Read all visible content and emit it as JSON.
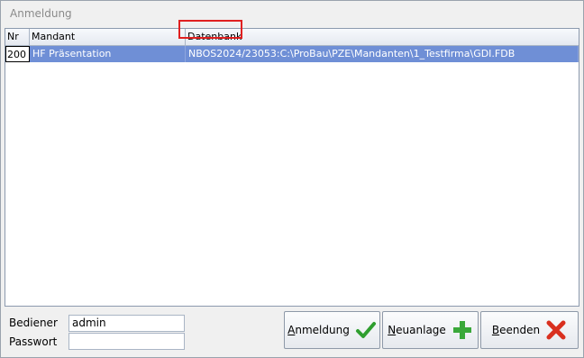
{
  "window": {
    "title": "Anmeldung"
  },
  "grid": {
    "columns": [
      "Nr",
      "Mandant",
      "Datenbank"
    ],
    "rows": [
      {
        "nr": "200",
        "mandant": "HF  Präsentation",
        "datenbank": "NBOS2024/23053:C:\\ProBau\\PZE\\Mandanten\\1_Testfirma\\GDI.FDB"
      }
    ]
  },
  "form": {
    "user_label": "Bediener",
    "user_value": "admin",
    "password_label": "Passwort",
    "password_value": ""
  },
  "buttons": {
    "login": {
      "mnemonic": "A",
      "rest": "nmeldung"
    },
    "new": {
      "mnemonic": "N",
      "rest": "euanlage"
    },
    "quit": {
      "mnemonic": "B",
      "rest": "eenden"
    }
  },
  "icons": {
    "login": "check-icon",
    "new": "plus-icon",
    "quit": "x-icon"
  },
  "colors": {
    "selection": "#6f8fd6",
    "highlight": "#e02020",
    "check": "#2f9e2f",
    "plus": "#3aa83a",
    "x": "#d9301f"
  }
}
